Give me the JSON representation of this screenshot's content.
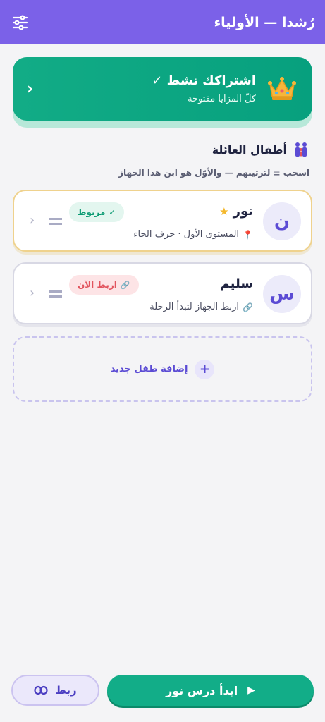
{
  "app_bar": {
    "title": "رُشدا — الأولياء",
    "settings_icon": "sliders-icon"
  },
  "subscription": {
    "title": "اشتراكك نشط ✓",
    "subtitle": "كلّ المزايا مفتوحة",
    "icon": "crown-icon",
    "chevron": "‹"
  },
  "family": {
    "title": "أطفال العائلة",
    "icon": "family-icon",
    "hint": "اسحب ≡ لترتيبهم — والأوّل هو ابن هذا الجهاز"
  },
  "children": [
    {
      "initial": "ن",
      "name": "نور",
      "star": "★",
      "meta": "المستوى الأول · حرف الحاء",
      "meta_icon": "📍",
      "badge": "مربوط",
      "badge_icon": "✓",
      "chevron": "‹"
    },
    {
      "initial": "س",
      "name": "سليم",
      "meta": "اربط الجهاز لتبدأ الرحلة",
      "meta_icon": "🔗",
      "badge": "اربط الآن",
      "badge_icon": "🔗",
      "chevron": "‹"
    }
  ],
  "add_child": {
    "label": "إضافة طفل جديد",
    "icon": "+"
  },
  "actions": {
    "start_label": "ابدأ درس نور",
    "start_icon": "▶",
    "link_label": "ربط"
  },
  "colors": {
    "primary": "#7b61e8",
    "success": "#12ad88",
    "danger": "#e2545e",
    "accent_star": "#f4b82c"
  }
}
